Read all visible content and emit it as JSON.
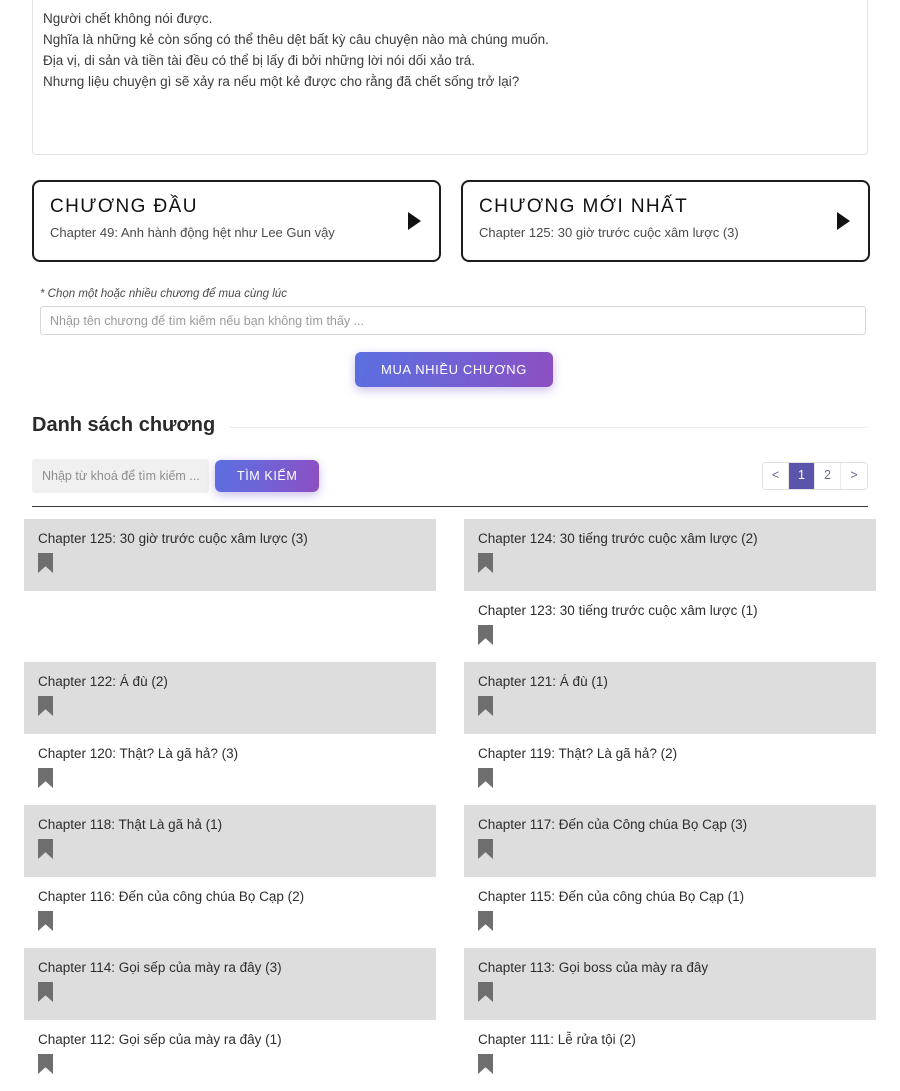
{
  "description": {
    "lines": [
      "Người chết không nói được.",
      "Nghĩa là những kẻ còn sống có thể thêu dệt bất kỳ câu chuyện nào mà chúng muốn.",
      "Địa vị, di sản và tiền tài đều có thể bị lấy đi bởi những lời nói dối xảo trá.",
      "Nhưng liệu chuyện gì sẽ xảy ra nếu một kẻ được cho rằng đã chết sống trở lại?"
    ]
  },
  "nav": {
    "first": {
      "title": "CHƯƠNG ĐẦU",
      "subtitle": "Chapter 49: Anh hành động hệt như Lee Gun vậy",
      "arrow_icon": "play-triangle-icon"
    },
    "latest": {
      "title": "CHƯƠNG MỚI NHẤT",
      "subtitle": "Chapter 125: 30 giờ trước cuộc xâm lược (3)",
      "arrow_icon": "play-triangle-icon"
    }
  },
  "bulk": {
    "note": "* Chọn một hoặc nhiều chương để mua cùng lúc",
    "input_placeholder": "Nhập tên chương để tìm kiếm nếu bạn không tìm thấy ...",
    "input_value": "",
    "button_label": "MUA NHIỀU CHƯƠNG"
  },
  "section": {
    "title": "Danh sách chương"
  },
  "search": {
    "placeholder": "Nhập từ khoá để tìm kiếm ...",
    "value": "",
    "button_label": "TÌM KIẾM"
  },
  "pagination": {
    "prev": "<",
    "next": ">",
    "pages": [
      "1",
      "2"
    ],
    "active": "1"
  },
  "colors": {
    "accent_start": "#5b6fe0",
    "accent_end": "#8d4fc2",
    "pager_active": "#5b54ab",
    "row_shade": "#dddddd",
    "bookmark": "#6e6e6e"
  },
  "chapters": [
    {
      "title": "Chapter 125: 30 giờ trước cuộc xâm lược (3)",
      "shade": true,
      "empty": false,
      "bookmark_icon": "bookmark-icon"
    },
    {
      "title": "Chapter 124: 30 tiếng trước cuộc xâm lược (2)",
      "shade": true,
      "empty": false,
      "bookmark_icon": "bookmark-icon"
    },
    {
      "title": "",
      "shade": false,
      "empty": true,
      "bookmark_icon": ""
    },
    {
      "title": "Chapter 123: 30 tiếng trước cuộc xâm lược (1)",
      "shade": false,
      "empty": false,
      "bookmark_icon": "bookmark-icon"
    },
    {
      "title": "Chapter 122: Á đù (2)",
      "shade": true,
      "empty": false,
      "bookmark_icon": "bookmark-icon"
    },
    {
      "title": "Chapter 121: Á đù (1)",
      "shade": true,
      "empty": false,
      "bookmark_icon": "bookmark-icon"
    },
    {
      "title": "Chapter 120: Thật? Là gã hả? (3)",
      "shade": false,
      "empty": false,
      "bookmark_icon": "bookmark-icon"
    },
    {
      "title": "Chapter 119: Thật? Là gã hả? (2)",
      "shade": false,
      "empty": false,
      "bookmark_icon": "bookmark-icon"
    },
    {
      "title": "Chapter 118: Thật Là gã hả (1)",
      "shade": true,
      "empty": false,
      "bookmark_icon": "bookmark-icon"
    },
    {
      "title": "Chapter 117: Đến của Công chúa Bọ Cạp (3)",
      "shade": true,
      "empty": false,
      "bookmark_icon": "bookmark-icon"
    },
    {
      "title": "Chapter 116: Đến của công chúa Bọ Cạp (2)",
      "shade": false,
      "empty": false,
      "bookmark_icon": "bookmark-icon"
    },
    {
      "title": "Chapter 115: Đến của công chúa Bọ Cạp (1)",
      "shade": false,
      "empty": false,
      "bookmark_icon": "bookmark-icon"
    },
    {
      "title": "Chapter 114: Gọi sếp của mày ra đây (3)",
      "shade": true,
      "empty": false,
      "bookmark_icon": "bookmark-icon"
    },
    {
      "title": "Chapter 113: Gọi boss của mày ra đây",
      "shade": true,
      "empty": false,
      "bookmark_icon": "bookmark-icon"
    },
    {
      "title": "Chapter 112: Gọi sếp của mày ra đây (1)",
      "shade": false,
      "empty": false,
      "bookmark_icon": "bookmark-icon"
    },
    {
      "title": "Chapter 111: Lễ rửa tội (2)",
      "shade": false,
      "empty": false,
      "bookmark_icon": "bookmark-icon"
    }
  ]
}
